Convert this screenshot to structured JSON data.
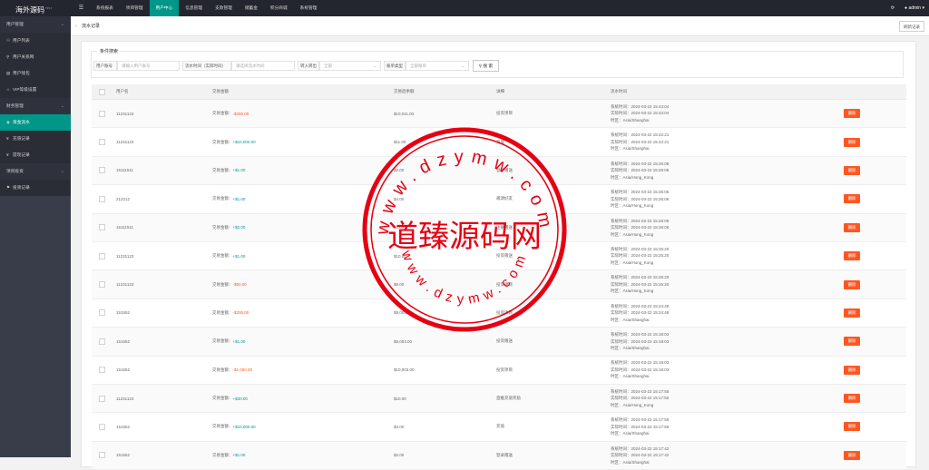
{
  "app": {
    "logo": "海外源码",
    "logo_sup": "TPL7",
    "user": "admin",
    "refresh_icon": "refresh-icon"
  },
  "nav": {
    "menu_icon": "☰",
    "items": [
      "系统报表",
      "项目管理",
      "用户中心",
      "信息管理",
      "支款管理",
      "储蓄金",
      "积分商城",
      "系统管理"
    ],
    "active_index": 2
  },
  "sidebar": [
    {
      "label": "用户管理",
      "type": "group",
      "icon": "",
      "chev": "⌄"
    },
    {
      "label": "用户列表",
      "type": "sub",
      "icon": "user-icon"
    },
    {
      "label": "用户关系网",
      "type": "sub",
      "icon": "network-icon"
    },
    {
      "label": "用户钱包",
      "type": "sub",
      "icon": "wallet-icon"
    },
    {
      "label": "VIP等级设置",
      "type": "sub",
      "icon": "star-icon"
    },
    {
      "label": "财务管理",
      "type": "group",
      "icon": "",
      "chev": "⌄"
    },
    {
      "label": "资金流水",
      "type": "sub",
      "icon": "coin-icon",
      "active": true
    },
    {
      "label": "充值记录",
      "type": "sub",
      "icon": "yen-icon"
    },
    {
      "label": "提现记录",
      "type": "sub",
      "icon": "yen-icon"
    },
    {
      "label": "项目投资",
      "type": "group",
      "icon": "",
      "chev": "⌄"
    },
    {
      "label": "投资记录",
      "type": "sub",
      "icon": "flag-icon"
    }
  ],
  "tab": {
    "arrow": "›",
    "title": "流水记录",
    "refresh_label": "刷新记录"
  },
  "filters": {
    "legend": "条件搜索",
    "phone_label": "用户账号",
    "phone_placeholder": "请输入用户账号",
    "time_label": "流水时间（实际时间）",
    "time_placeholder": "请选择流水时间",
    "type_label": "转入转出",
    "type_value": "全部",
    "ledger_label": "账单类型",
    "ledger_value": "全部账单",
    "search_label": "搜 索"
  },
  "table": {
    "headers": {
      "user": "用户名",
      "amount": "交易金额",
      "balance": "交易后余额",
      "detail": "详细",
      "time": "流水时间"
    },
    "rows": [
      {
        "user": "11231123",
        "amount_prefix": "交易金额：",
        "amount": "-$250.00",
        "sign": "neg",
        "balance": "$10,011.00",
        "detail": "投资项目",
        "t1": "系统时间：2024-03-22 15:43:04",
        "t2": "实际时间：2024-03-22 15:43:04",
        "t3": "时区：Asia/Shanghai",
        "action": "删除"
      },
      {
        "user": "11231123",
        "amount_prefix": "交易金额：",
        "amount": "+$10,000.00",
        "sign": "pos",
        "balance": "$11.00",
        "detail": "充值",
        "t1": "系统时间：2024-03-22 15:42:21",
        "t2": "实际时间：2024-03-22 15:42:21",
        "t3": "时区：Asia/Shanghai",
        "action": "删除"
      },
      {
        "user": "15111511",
        "amount_prefix": "交易金额：",
        "amount": "+$1.00",
        "sign": "pos",
        "balance": "$2.00",
        "detail": "登录赠送",
        "t1": "系统时间：2024-03-22 15:26:08",
        "t2": "实际时间：2024-03-22 15:26:08",
        "t3": "时区：Asia/Hong_Kong",
        "action": "删除"
      },
      {
        "user": "212212",
        "amount_prefix": "交易金额：",
        "amount": "+$1.00",
        "sign": "pos",
        "balance": "$4.00",
        "detail": "邀请好友",
        "t1": "系统时间：2024-03-22 15:26:06",
        "t2": "实际时间：2024-03-22 15:26:06",
        "t3": "时区：Asia/Hong_Kong",
        "action": "删除"
      },
      {
        "user": "15111511",
        "amount_prefix": "交易金额：",
        "amount": "+$2.00",
        "sign": "pos",
        "balance": "$0.00",
        "detail": "注册赠送",
        "t1": "系统时间：2024-03-22 15:26:06",
        "t2": "实际时间：2024-03-22 15:26:06",
        "t3": "时区：Asia/Hong_Kong",
        "action": "删除"
      },
      {
        "user": "11231123",
        "amount_prefix": "交易金额：",
        "amount": "+$1.00",
        "sign": "pos",
        "balance": "$10.00",
        "detail": "投资赠送",
        "t1": "系统时间：2024-03-22 15:25:20",
        "t2": "实际时间：2024-03-22 15:25:20",
        "t3": "时区：Asia/Hong_Kong",
        "action": "删除"
      },
      {
        "user": "11231123",
        "amount_prefix": "交易金额：",
        "amount": "-$50.00",
        "sign": "neg",
        "balance": "$9.00",
        "detail": "投资项目",
        "t1": "系统时间：2024-03-22 15:25:20",
        "t2": "实际时间：2024-03-22 15:25:20",
        "t3": "时区：Asia/Hong_Kong",
        "action": "删除"
      },
      {
        "user": "151552",
        "amount_prefix": "交易金额：",
        "amount": "-$200.00",
        "sign": "neg",
        "balance": "$9,004.00",
        "detail": "投资项目",
        "t1": "系统时间：2024-03-22 15:24:48",
        "t2": "实际时间：2024-03-22 15:24:48",
        "t3": "时区：Asia/Shanghai",
        "action": "删除"
      },
      {
        "user": "151552",
        "amount_prefix": "交易金额：",
        "amount": "+$1.00",
        "sign": "pos",
        "balance": "$9,003.00",
        "detail": "投资赠送",
        "t1": "系统时间：2024-03-22 15:18:03",
        "t2": "实际时间：2024-03-22 15:18:03",
        "t3": "时区：Asia/Shanghai",
        "action": "删除"
      },
      {
        "user": "151552",
        "amount_prefix": "交易金额：",
        "amount": "-$1,000.00",
        "sign": "neg",
        "balance": "$10,003.00",
        "detail": "投资项目",
        "t1": "系统时间：2024-03-22 15:18:03",
        "t2": "实际时间：2024-03-22 15:18:03",
        "t3": "时区：Asia/Shanghai",
        "action": "删除"
      },
      {
        "user": "11231123",
        "amount_prefix": "交易金额：",
        "amount": "+$30.00",
        "sign": "pos",
        "balance": "$10.00",
        "detail": "直推充值奖励",
        "t1": "系统时间：2024-03-22 15:17:55",
        "t2": "实际时间：2024-03-22 15:17:55",
        "t3": "时区：Asia/Hong_Kong",
        "action": "删除"
      },
      {
        "user": "151552",
        "amount_prefix": "交易金额：",
        "amount": "+$10,000.00",
        "sign": "pos",
        "balance": "$3.00",
        "detail": "充值",
        "t1": "系统时间：2024-03-22 15:17:55",
        "t2": "实际时间：2024-03-22 15:17:55",
        "t3": "时区：Asia/Shanghai",
        "action": "删除"
      },
      {
        "user": "151552",
        "amount_prefix": "交易金额：",
        "amount": "+$1.00",
        "sign": "pos",
        "balance": "$2.00",
        "detail": "登录赠送",
        "t1": "系统时间：2024-03-22 15:17:42",
        "t2": "实际时间：2024-03-22 15:17:42",
        "t3": "时区：Asia/Shanghai",
        "action": "删除"
      }
    ]
  },
  "watermark": {
    "title": "道臻源码网",
    "url_top": "www.dzymw.com",
    "url_bottom": "www.dzymw.com",
    "color": "#e60012"
  },
  "colors": {
    "accent": "#009688",
    "danger": "#ff5722",
    "topbar": "#23262e",
    "sidebar": "#393d49"
  }
}
